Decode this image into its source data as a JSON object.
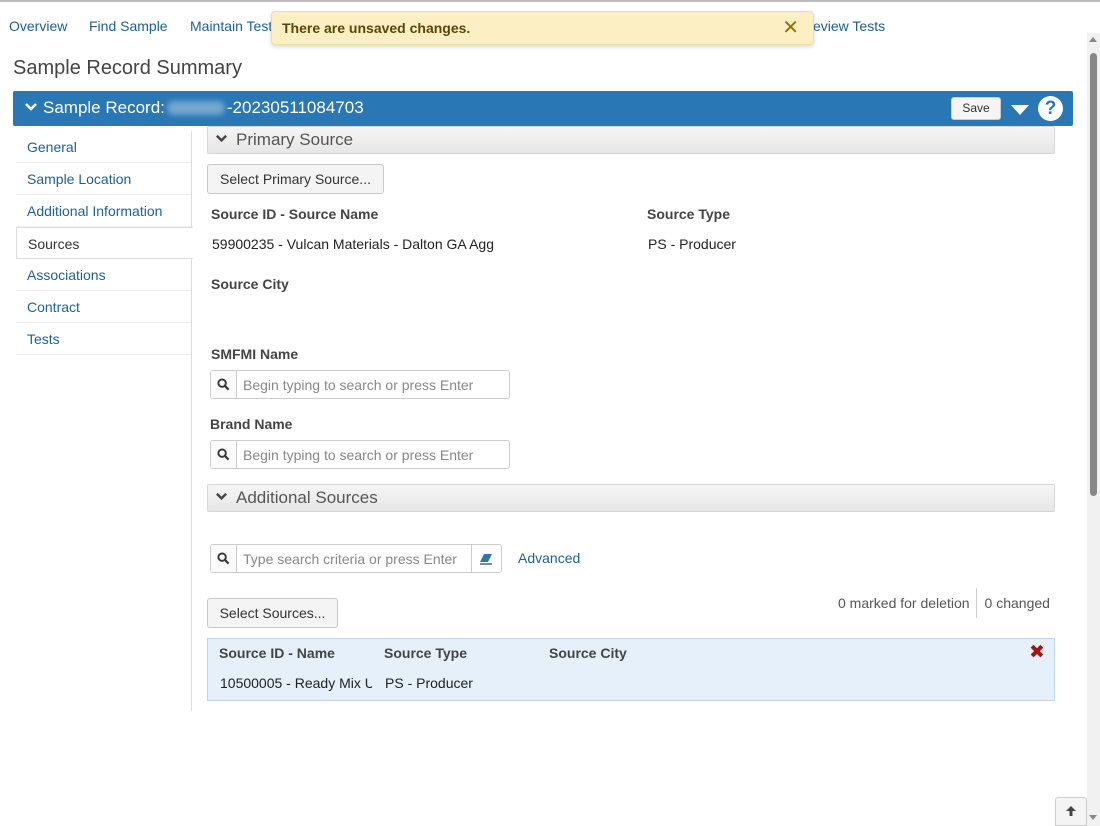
{
  "nav": {
    "items": [
      {
        "label": "Overview"
      },
      {
        "label": "Find Sample"
      },
      {
        "label": "Maintain Test"
      },
      {
        "label": "eview Tests"
      }
    ]
  },
  "toast": {
    "message": "There are unsaved changes.",
    "close_glyph": "✕"
  },
  "page": {
    "title": "Sample Record Summary"
  },
  "record": {
    "prefix": "Sample Record:",
    "suffix": "-20230511084703",
    "save_label": "Save",
    "help_glyph": "?"
  },
  "sidebar": {
    "items": [
      {
        "label": "General"
      },
      {
        "label": "Sample Location"
      },
      {
        "label": "Additional Information"
      },
      {
        "label": "Sources"
      },
      {
        "label": "Associations"
      },
      {
        "label": "Contract"
      },
      {
        "label": "Tests"
      }
    ],
    "active": "Sources"
  },
  "primary_source": {
    "title": "Primary Source",
    "select_button": "Select Primary Source...",
    "source_id_label": "Source ID - Source Name",
    "source_id_value": "59900235 - Vulcan Materials - Dalton GA Agg",
    "source_type_label": "Source Type",
    "source_type_value": "PS - Producer",
    "source_city_label": "Source City",
    "smfmi_label": "SMFMI Name",
    "smfmi_placeholder": "Begin typing to search or press Enter",
    "brand_label": "Brand Name",
    "brand_placeholder": "Begin typing to search or press Enter"
  },
  "additional_sources": {
    "title": "Additional Sources",
    "search_placeholder": "Type search criteria or press Enter",
    "advanced_link": "Advanced",
    "select_button": "Select Sources...",
    "marked_for_deletion": "0 marked for deletion",
    "changed": "0 changed",
    "columns": [
      "Source ID - Name",
      "Source Type",
      "Source City"
    ],
    "rows": [
      {
        "source_id_name": "10500005 - Ready Mix U",
        "source_type": "PS - Producer",
        "source_city": ""
      }
    ],
    "delete_glyph": "✖"
  },
  "colors": {
    "accent": "#2a77b5",
    "link": "#1f5f96",
    "toast_bg": "#fcefc4",
    "delete": "#a31515"
  }
}
